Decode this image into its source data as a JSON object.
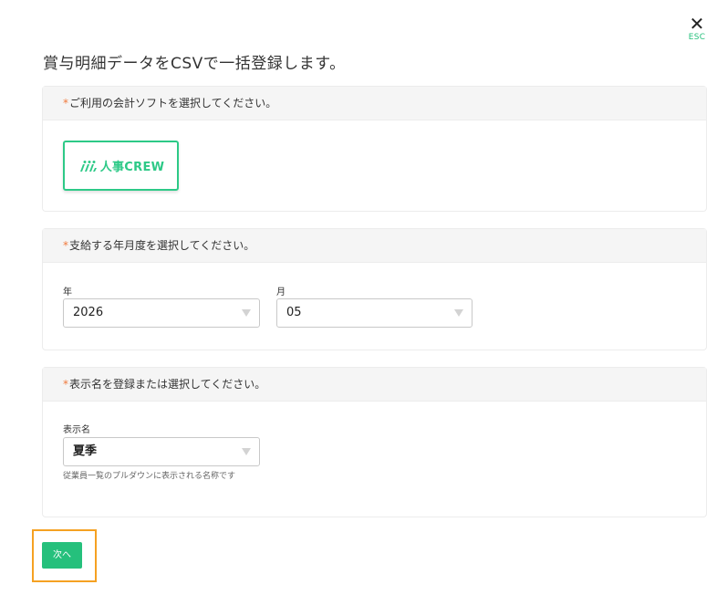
{
  "modal": {
    "close_glyph": "✕",
    "close_hint": "ESC",
    "title": "賞与明細データをCSVで一括登録します。"
  },
  "software_section": {
    "required_mark": "*",
    "heading": "ご利用の会計ソフトを選択してください。",
    "options": [
      {
        "name": "人事CREW",
        "logo_icon": "jinji-crew-logo-icon",
        "selected": true
      }
    ]
  },
  "period_section": {
    "required_mark": "*",
    "heading": "支給する年月度を選択してください。",
    "year": {
      "label": "年",
      "value": "2026"
    },
    "month": {
      "label": "月",
      "value": "05"
    }
  },
  "display_name_section": {
    "required_mark": "*",
    "heading": "表示名を登録または選択してください。",
    "field": {
      "label": "表示名",
      "value": "夏季",
      "help": "従業員一覧のプルダウンに表示される名称です"
    }
  },
  "actions": {
    "next_label": "次へ"
  },
  "colors": {
    "accent": "#25c07c",
    "required": "#f07a3c",
    "highlight": "#f5a122"
  }
}
